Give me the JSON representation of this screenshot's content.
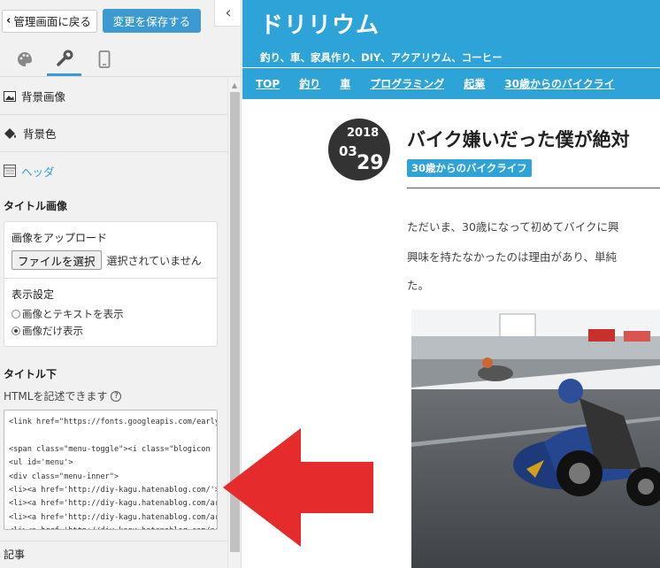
{
  "toolbar": {
    "back_label": "管理画面に戻る",
    "save_label": "変更を保存する"
  },
  "sections": {
    "bg_image": "背景画像",
    "bg_color": "背景色",
    "header": "ヘッダ"
  },
  "title_image": {
    "heading": "タイトル画像",
    "upload_label": "画像をアップロード",
    "file_button": "ファイルを選択",
    "file_status": "選択されていません",
    "display_heading": "表示設定",
    "options": [
      "画像とテキストを表示",
      "画像だけ表示"
    ],
    "selected_option": "画像だけ表示"
  },
  "title_below": {
    "heading": "タイトル下",
    "hint": "HTMLを記述できます",
    "hint_icon": "?",
    "code_lines": [
      "<link href=\"https://fonts.googleapis.com/earlyac",
      "",
      "<span class=\"menu-toggle\"><i class=\"blogicon",
      "<ul id='menu'>",
      "<div class=\"menu-inner\">",
      "<li><a href='http://diy-kagu.hatenablog.com/'>",
      "<li><a href='http://diy-kagu.hatenablog.com/ar",
      "<li><a href='http://diy-kagu.hatenablog.com/ar",
      "<li><a href='http://diy-kagu.hatenablog.com/ar"
    ]
  },
  "next_section": "記事",
  "blog": {
    "title": "ドリリウム",
    "tagline": "釣り、車、家具作り、DIY、アクアリウム、コーヒー",
    "nav": [
      "TOP",
      "釣り",
      "車",
      "プログラミング",
      "起業",
      "30歳からのバイクライ"
    ],
    "date": {
      "year": "2018",
      "month": "03",
      "day": "29"
    },
    "post_title": "バイク嫌いだった僕が絶対",
    "category": "30歳からのバイクライフ",
    "para1": "ただいま、30歳になって初めてバイクに興",
    "para2": "興味を持たなかったのは理由があり、単純",
    "para3": "た。"
  },
  "colors": {
    "accent": "#2ea3d7",
    "arrow": "#e52b2b"
  }
}
